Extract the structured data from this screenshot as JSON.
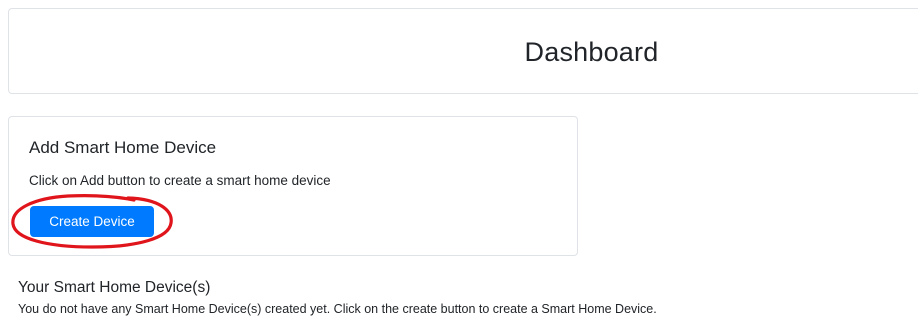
{
  "header": {
    "title": "Dashboard"
  },
  "add_device_card": {
    "title": "Add Smart Home Device",
    "description": "Click on Add button to create a smart home device",
    "button_label": "Create Device",
    "button_color": "#007bff",
    "annotation_color": "#e0141b"
  },
  "devices_section": {
    "title": "Your Smart Home Device(s)",
    "empty_message": "You do not have any Smart Home Device(s) created yet. Click on the create button to create a Smart Home Device."
  }
}
